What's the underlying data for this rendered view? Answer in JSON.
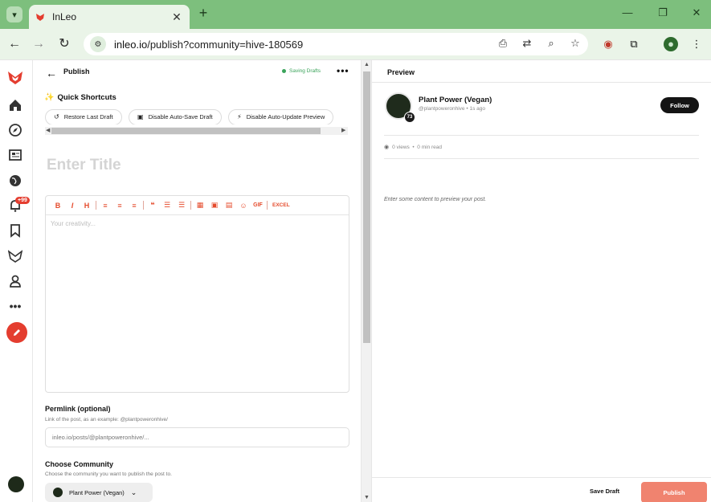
{
  "browser": {
    "tab_title": "InLeo",
    "url_host": "inleo.io",
    "url_path": "/publish?community=hive-180569"
  },
  "nav": {
    "notification_count": "+99"
  },
  "editor": {
    "header_title": "Publish",
    "saving_status": "Saving Drafts",
    "quick_shortcuts_title": "Quick Shortcuts",
    "shortcuts": [
      "Restore Last Draft",
      "Disable Auto-Save Draft",
      "Disable Auto-Update Preview"
    ],
    "title_placeholder": "Enter Title",
    "toolbar_gif": "GIF",
    "toolbar_excel": "EXCEL",
    "body_placeholder": "Your creativity...",
    "permlink_label": "Permlink (optional)",
    "permlink_hint": "Link of the post, as an example: @plantpoweronhive/",
    "permlink_placeholder": "inleo.io/posts/@plantpoweronhive/...",
    "community_label": "Choose Community",
    "community_hint": "Choose the community you want to publish the post to.",
    "community_selected": "Plant Power (Vegan)"
  },
  "preview": {
    "title": "Preview",
    "author_name": "Plant Power (Vegan)",
    "author_handle": "@plantpoweronhive",
    "post_age": "1s ago",
    "reputation": "73",
    "follow_label": "Follow",
    "views": "0 views",
    "read_time": "0 min read",
    "empty_message": "Enter some content to preview your post.",
    "save_draft_label": "Save Draft",
    "publish_label": "Publish"
  },
  "colors": {
    "chrome_green": "#7dbf7d",
    "accent_red": "#e43d2f",
    "publish_button": "#f0836f"
  }
}
